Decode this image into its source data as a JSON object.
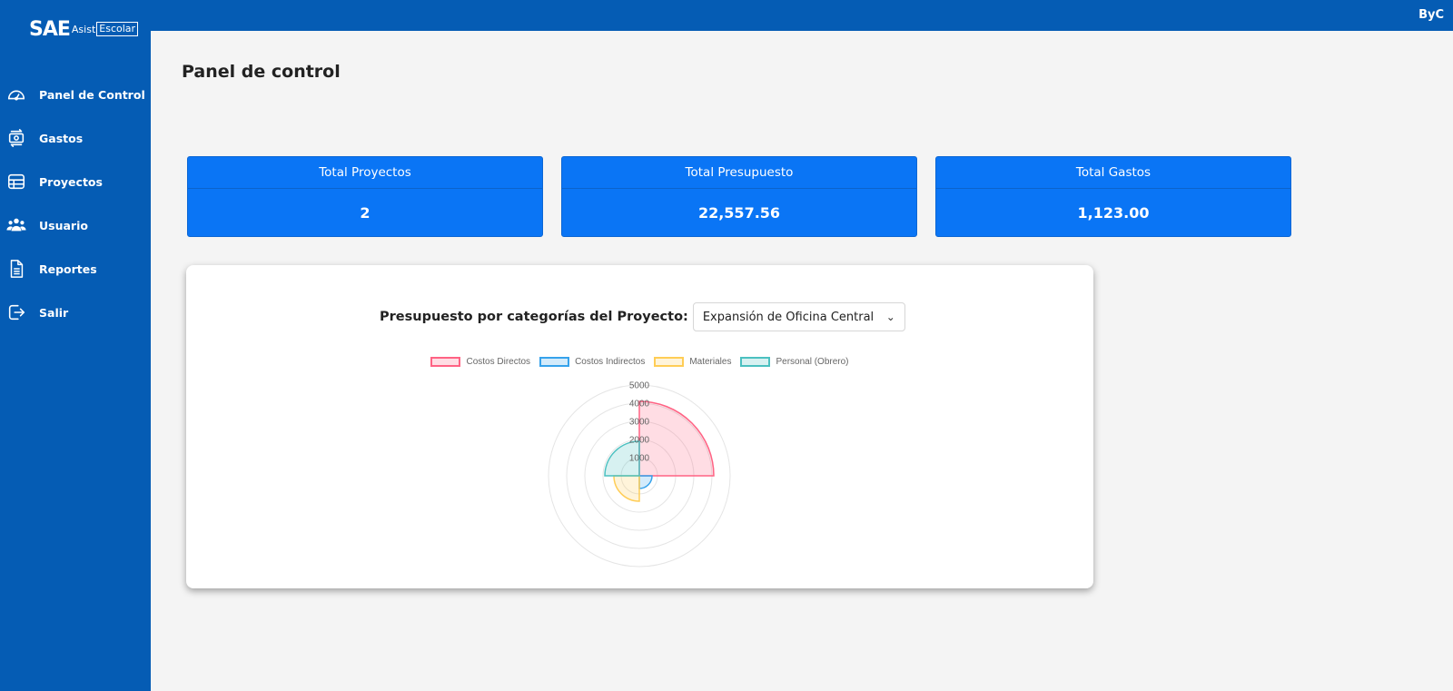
{
  "brand": {
    "logo_main": "SAE",
    "logo_sub_a": "Asist",
    "logo_sub_b": "Escolar"
  },
  "header": {
    "user": "ByC"
  },
  "sidebar": {
    "items": [
      {
        "label": "Panel de Control",
        "icon": "dashboard-icon"
      },
      {
        "label": "Gastos",
        "icon": "money-transfer-icon"
      },
      {
        "label": "Proyectos",
        "icon": "table-icon"
      },
      {
        "label": "Usuario",
        "icon": "users-icon"
      },
      {
        "label": "Reportes",
        "icon": "document-icon"
      },
      {
        "label": "Salir",
        "icon": "logout-icon"
      }
    ]
  },
  "page": {
    "title": "Panel de control"
  },
  "cards": [
    {
      "title": "Total Proyectos",
      "value": "2"
    },
    {
      "title": "Total Presupuesto",
      "value": "22,557.56"
    },
    {
      "title": "Total Gastos",
      "value": "1,123.00"
    }
  ],
  "chart_panel": {
    "title": "Presupuesto por categorías del Proyecto:",
    "select_value": "Expansión de Oficina Central"
  },
  "chart_data": {
    "type": "polarArea",
    "categories": [
      "Costos Directos",
      "Costos Indirectos",
      "Materiales",
      "Personal (Obrero)"
    ],
    "values": [
      4100,
      700,
      1400,
      1900
    ],
    "r_ticks": [
      "1000",
      "2000",
      "3000",
      "4000",
      "5000"
    ],
    "rlim": [
      0,
      5000
    ],
    "colors": {
      "border": [
        "#ff6384",
        "#36a2eb",
        "#ffcd56",
        "#4bc0c0"
      ],
      "fill": [
        "rgba(255,99,132,0.22)",
        "rgba(54,162,235,0.22)",
        "rgba(255,205,86,0.22)",
        "rgba(75,192,192,0.22)"
      ]
    },
    "legend_position": "top"
  }
}
